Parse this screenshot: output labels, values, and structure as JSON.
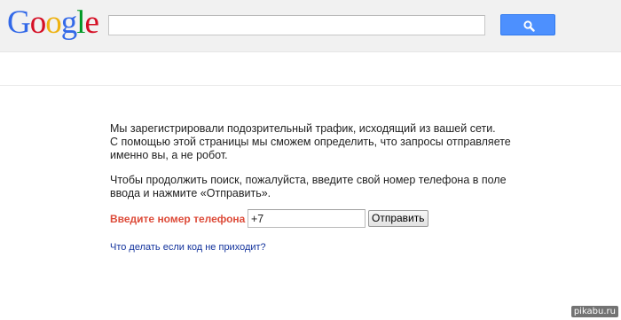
{
  "header": {
    "logo": {
      "letters": [
        "G",
        "o",
        "o",
        "g",
        "l",
        "e"
      ],
      "colors": [
        "#3369e8",
        "#d50f25",
        "#eeb211",
        "#3369e8",
        "#009925",
        "#d50f25"
      ]
    },
    "search": {
      "value": "",
      "placeholder": ""
    },
    "search_button": {
      "icon": "search-icon",
      "color": "#4d90fe"
    }
  },
  "main": {
    "paragraph1": {
      "lines": [
        "Мы зарегистрировали подозрительный трафик, исходящий из вашей сети.",
        "С помощью этой страницы мы сможем определить, что запросы отправляете",
        "именно вы, а не робот."
      ]
    },
    "paragraph2": {
      "lines": [
        "Чтобы продолжить поиск, пожалуйста, введите свой номер телефона в поле",
        "ввода и нажмите «Отправить»."
      ]
    },
    "phone_label": "Введите номер телефона",
    "phone_value": "+7",
    "submit_label": "Отправить",
    "help_link": "Что делать если код не приходит?"
  },
  "watermark": "pikabu.ru"
}
